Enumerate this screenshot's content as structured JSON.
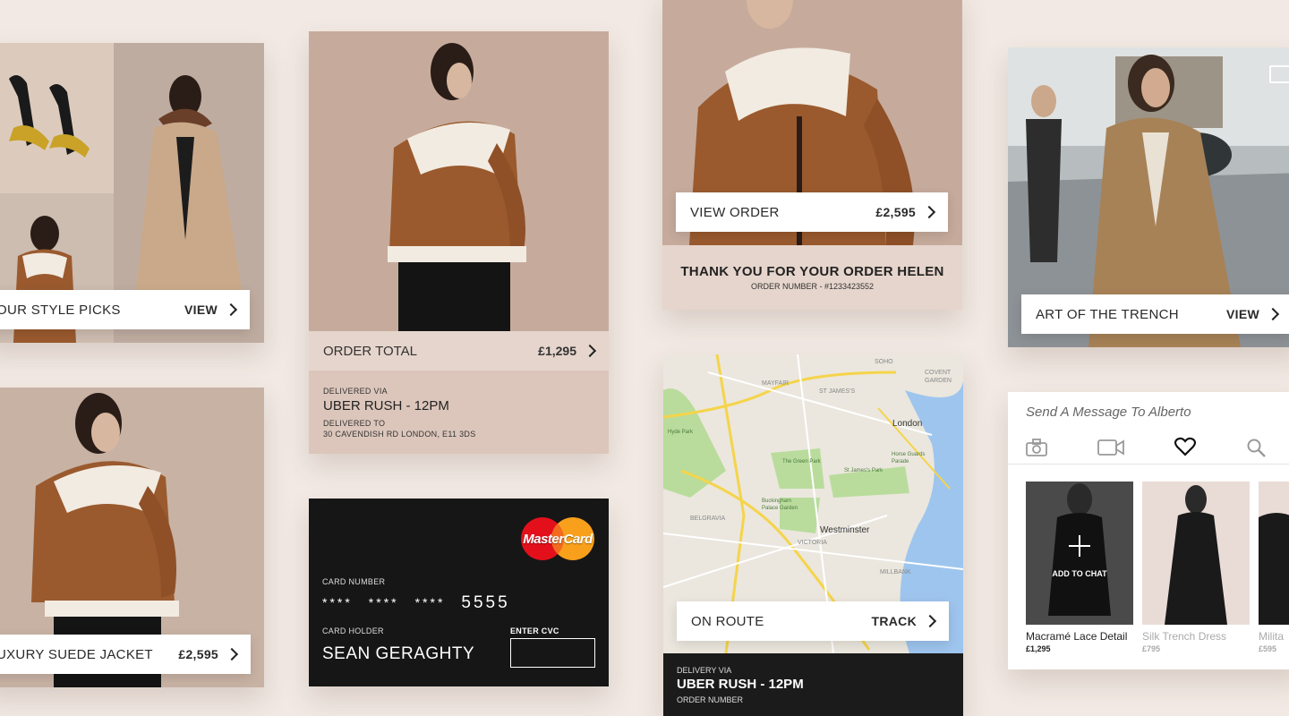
{
  "style_picks": {
    "label": "OUR STYLE PICKS",
    "action": "VIEW"
  },
  "suede_jacket": {
    "label": "UXURY SUEDE JACKET",
    "price": "£2,595"
  },
  "order_total": {
    "label": "ORDER TOTAL",
    "amount": "£1,295",
    "delivered_via_label": "DELIVERED VIA",
    "delivered_via": "UBER RUSH - 12PM",
    "delivered_to_label": "DELIVERED TO",
    "delivered_to": "30 CAVENDISH RD LONDON, E11 3DS"
  },
  "credit_card": {
    "brand": "MasterCard",
    "number_label": "CARD NUMBER",
    "number_mask": [
      "****",
      "****",
      "****"
    ],
    "number_last": "5555",
    "holder_label": "CARD HOLDER",
    "holder": "SEAN GERAGHTY",
    "cvc_label": "ENTER CVC",
    "cvc_value": ""
  },
  "view_order": {
    "label": "VIEW ORDER",
    "price": "£2,595",
    "thanks": "THANK YOU FOR YOUR ORDER HELEN",
    "order_number": "ORDER NUMBER - #1233423552"
  },
  "map": {
    "labels": {
      "soho": "SOHO",
      "covent_garden": "COVENT GARDEN",
      "mayfair": "MAYFAIR",
      "st_james": "ST JAMES'S",
      "london": "London",
      "hyde_park": "Hyde Park",
      "green_park": "The Green Park",
      "st_james_park": "St James's Park",
      "horse_guards": "Horse Guards Parade",
      "buckingham": "Buckingham Palace Garden",
      "belgravia": "BELGRAVIA",
      "victoria": "VICTORIA",
      "westminster": "Westminster",
      "millbank": "MILLBANK"
    },
    "status": "ON ROUTE",
    "action": "TRACK",
    "delivered_via_label": "DELIVERY VIA",
    "delivered_via": "UBER RUSH - 12PM",
    "order_number_label": "ORDER NUMBER"
  },
  "trench": {
    "label": "ART OF THE TRENCH",
    "action": "VIEW"
  },
  "chat": {
    "placeholder": "Send A Message To Alberto",
    "add_to_chat": "ADD TO CHAT",
    "products": [
      {
        "name": "Macramé Lace Detail",
        "price": "£1,295"
      },
      {
        "name": "Silk Trench Dress",
        "price": "£795"
      },
      {
        "name": "Milita",
        "price": "£595"
      }
    ]
  }
}
